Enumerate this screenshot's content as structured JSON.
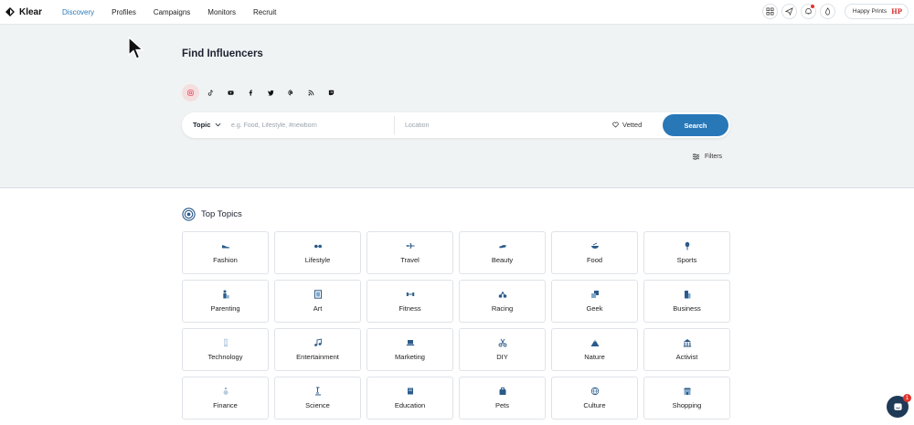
{
  "app": {
    "name": "Klear"
  },
  "nav": {
    "items": [
      {
        "label": "Discovery",
        "active": true
      },
      {
        "label": "Profiles",
        "active": false
      },
      {
        "label": "Campaigns",
        "active": false
      },
      {
        "label": "Monitors",
        "active": false
      },
      {
        "label": "Recruit",
        "active": false
      }
    ]
  },
  "header_actions": {
    "icons": [
      "grid-icon",
      "send-icon",
      "bell-icon",
      "fire-icon"
    ],
    "account_name": "Happy Prints",
    "account_logo": "HP"
  },
  "hero": {
    "title": "Find Influencers",
    "platforms": [
      {
        "icon": "instagram-icon",
        "active": true
      },
      {
        "icon": "tiktok-icon",
        "active": false
      },
      {
        "icon": "youtube-icon",
        "active": false
      },
      {
        "icon": "facebook-icon",
        "active": false
      },
      {
        "icon": "twitter-icon",
        "active": false
      },
      {
        "icon": "pinterest-icon",
        "active": false
      },
      {
        "icon": "rss-icon",
        "active": false
      },
      {
        "icon": "twitch-icon",
        "active": false
      }
    ],
    "search": {
      "topic_label": "Topic",
      "topic_placeholder": "e.g. Food, Lifestyle, #newborn",
      "location_placeholder": "Location",
      "vetted_label": "Vetted",
      "button_label": "Search"
    },
    "filters_label": "Filters"
  },
  "topics": {
    "title": "Top Topics",
    "items": [
      "Fashion",
      "Lifestyle",
      "Travel",
      "Beauty",
      "Food",
      "Sports",
      "Parenting",
      "Art",
      "Fitness",
      "Racing",
      "Geek",
      "Business",
      "Technology",
      "Entertainment",
      "Marketing",
      "DIY",
      "Nature",
      "Activist",
      "Finance",
      "Science",
      "Education",
      "Pets",
      "Culture",
      "Shopping"
    ]
  },
  "chat": {
    "badge": "1"
  },
  "colors": {
    "accent": "#2878b8",
    "hero_bg": "#f0f3f4",
    "alert": "#e0342c"
  }
}
